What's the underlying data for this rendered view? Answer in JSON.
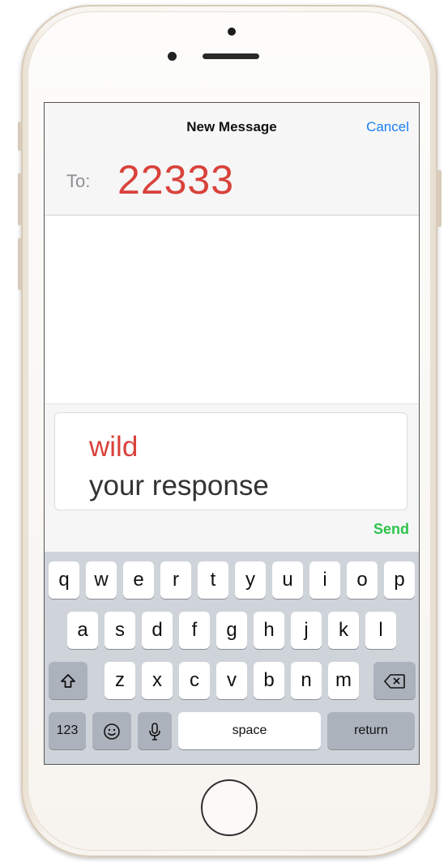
{
  "header": {
    "title": "New Message",
    "cancel_label": "Cancel"
  },
  "recipient": {
    "label": "To:",
    "value": "22333"
  },
  "compose": {
    "keyword": "wild",
    "hint": "your response"
  },
  "send_label": "Send",
  "keyboard": {
    "row1": [
      "q",
      "w",
      "e",
      "r",
      "t",
      "y",
      "u",
      "i",
      "o",
      "p"
    ],
    "row2": [
      "a",
      "s",
      "d",
      "f",
      "g",
      "h",
      "j",
      "k",
      "l"
    ],
    "row3": [
      "z",
      "x",
      "c",
      "v",
      "b",
      "n",
      "m"
    ],
    "numbers_label": "123",
    "space_label": "space",
    "return_label": "return",
    "icons": {
      "shift": "shift-icon",
      "delete": "delete-icon",
      "emoji": "emoji-icon",
      "mic": "microphone-icon"
    }
  },
  "colors": {
    "accent_red": "#d9423a",
    "link_blue": "#1a7ef2",
    "send_green": "#2dc44a"
  }
}
